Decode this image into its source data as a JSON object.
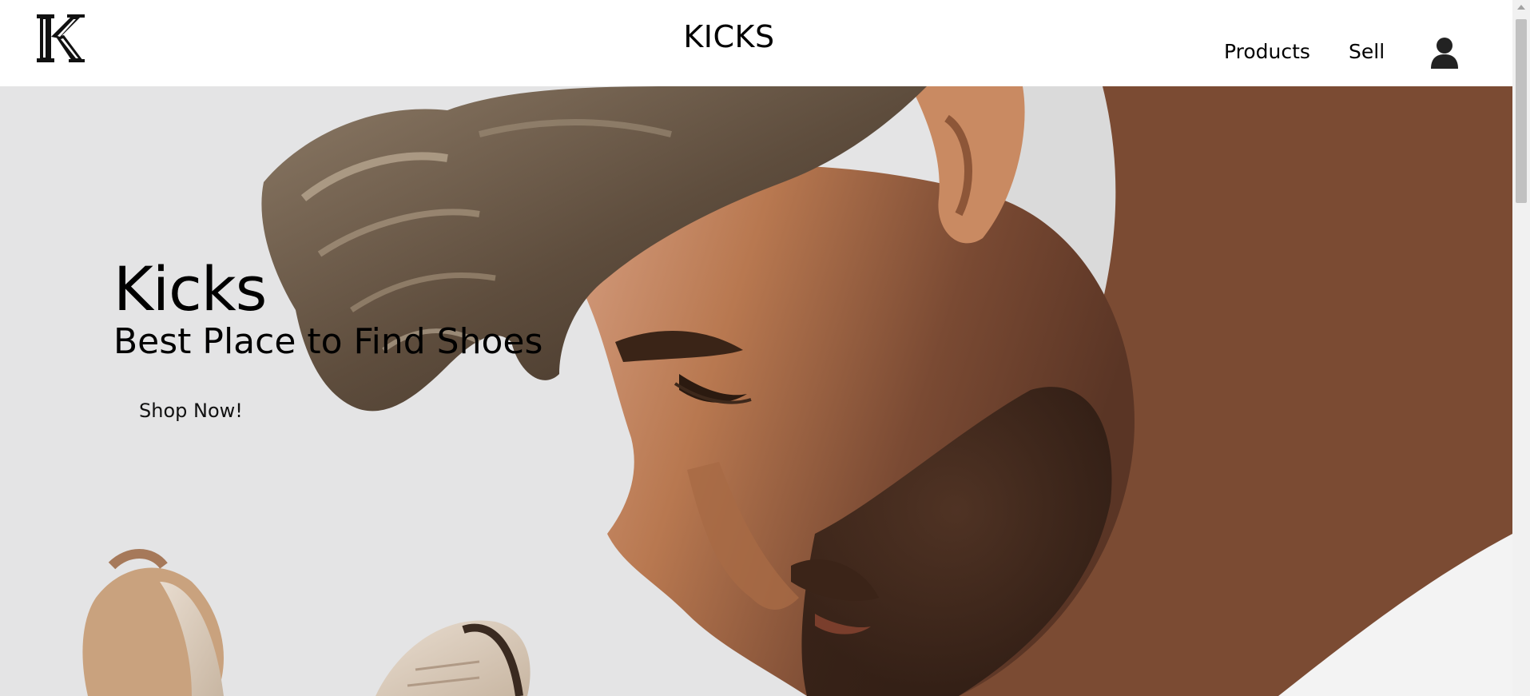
{
  "header": {
    "logo_letter": "K",
    "site_title": "KICKS",
    "nav": {
      "products_label": "Products",
      "sell_label": "Sell"
    },
    "icons": {
      "account": "user-icon"
    }
  },
  "hero": {
    "heading": "Kicks",
    "subheading": "Best Place to Find Shoes",
    "cta_label": "Shop Now!"
  },
  "colors": {
    "background": "#ffffff",
    "text": "#000000",
    "hero_bg": "#dedfe0",
    "skin": "#b97b56",
    "hair": "#6b5a48"
  }
}
